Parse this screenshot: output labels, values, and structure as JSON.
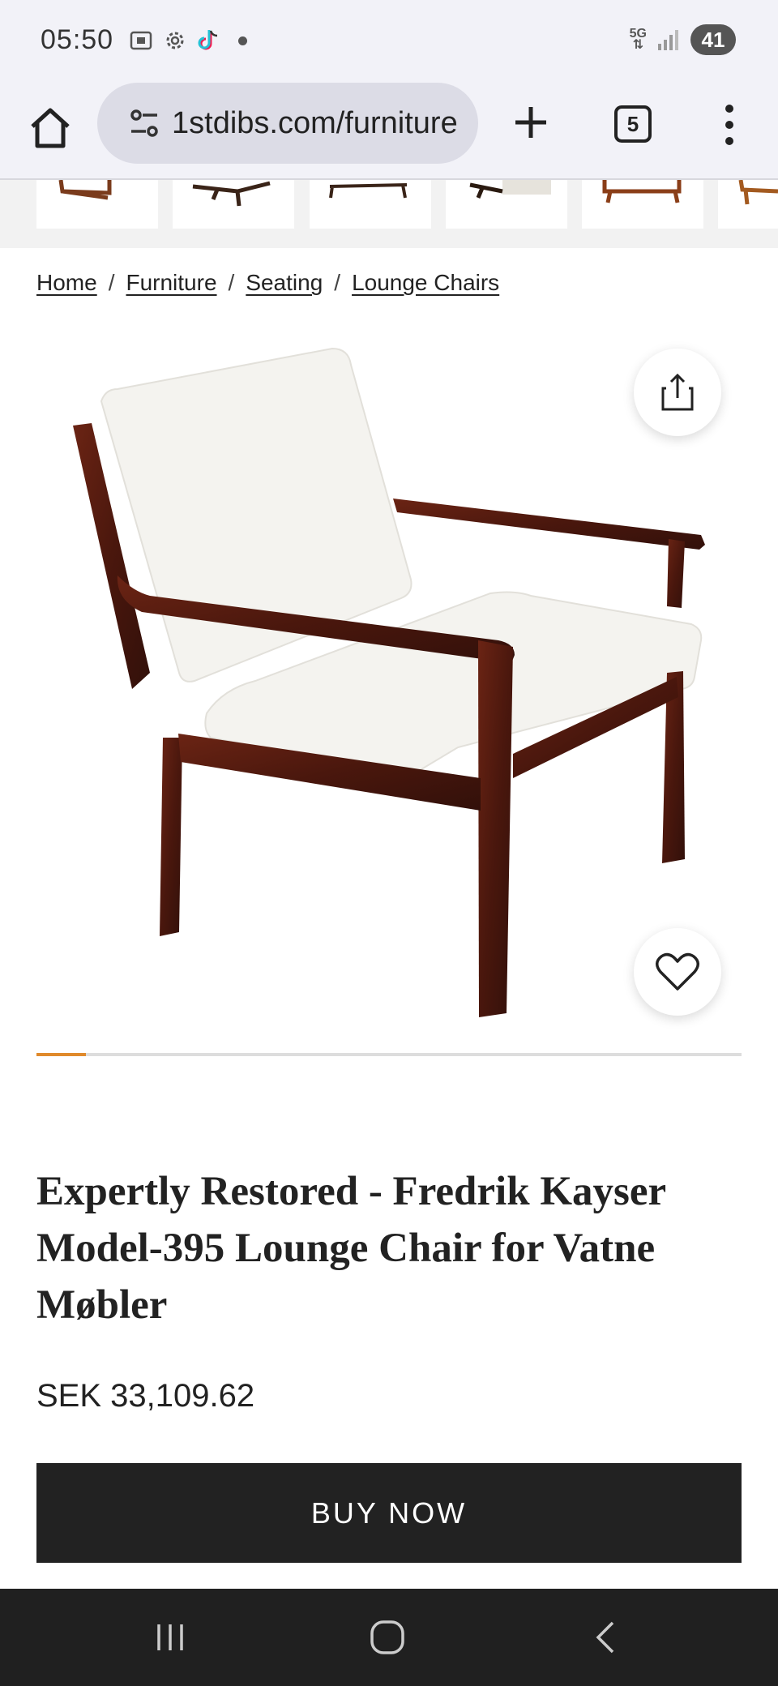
{
  "status_bar": {
    "time": "05:50",
    "network": "5G",
    "battery": "41",
    "icons": [
      "screenshot-icon",
      "settings-gear-icon",
      "tiktok-icon",
      "notification-dot-icon",
      "signal-icon"
    ]
  },
  "browser": {
    "url": "1stdibs.com/furniture",
    "tab_count": "5",
    "icons": [
      "home-icon",
      "site-settings-icon",
      "new-tab-plus-icon",
      "tab-switcher-icon",
      "more-menu-icon"
    ]
  },
  "breadcrumb": {
    "items": [
      "Home",
      "Furniture",
      "Seating",
      "Lounge Chairs"
    ],
    "separator": "/"
  },
  "product": {
    "image_alt": "Lounge chair with dark rosewood frame and white bouclé cushions",
    "title": "Expertly Restored - Fredrik Kayser Model-395 Lounge Chair for Vatne Møbler",
    "price": "SEK 33,109.62",
    "buy_label": "BUY NOW",
    "gallery_progress": 0.07
  },
  "colors": {
    "accent_progress": "#e08a2c",
    "button_bg": "#222222",
    "wood": "#5a1e12",
    "cushion": "#f4f3ef"
  },
  "nav": {
    "icons": [
      "recent-apps-icon",
      "home-circle-icon",
      "back-chevron-icon"
    ]
  }
}
